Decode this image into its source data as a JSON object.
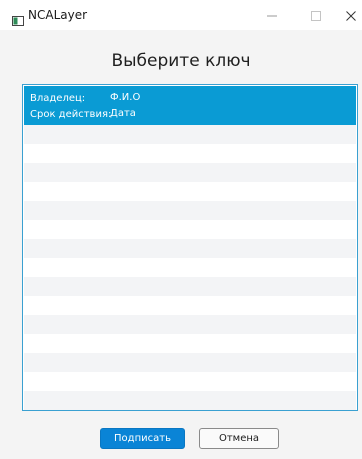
{
  "window": {
    "title": "NCALayer"
  },
  "dialog": {
    "heading": "Выберите ключ"
  },
  "key_list": {
    "selected_item": {
      "owner_label": "Владелец:",
      "owner_value": "Ф.И.О",
      "validity_label": "Срок действия:",
      "validity_value": "Дата"
    },
    "empty_rows": 15
  },
  "buttons": {
    "sign_label": "Подписать",
    "cancel_label": "Отмена"
  },
  "colors": {
    "selection": "#0a9bd4",
    "primary_button": "#0a84d6",
    "list_border": "#3aa0d1",
    "stripe": "#f3f4f6"
  },
  "icons": {
    "app": "ncalayer-app-icon",
    "minimize": "minimize-icon",
    "maximize": "maximize-icon",
    "close": "close-icon"
  }
}
